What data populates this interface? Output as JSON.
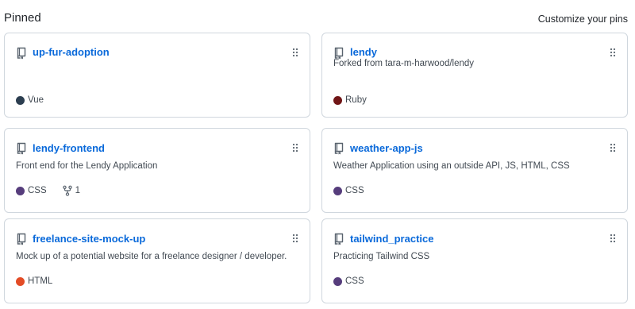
{
  "header": {
    "title": "Pinned",
    "customize": "Customize your pins"
  },
  "icons": {
    "repo": "repo-icon",
    "drag": "grabber-icon",
    "fork": "repo-forked-icon"
  },
  "cards": [
    {
      "name": "up-fur-adoption",
      "description": "",
      "language": "Vue",
      "language_color": "#2c3e50",
      "forks": ""
    },
    {
      "name": "lendy",
      "description": "Forked from tara-m-harwood/lendy",
      "language": "Ruby",
      "language_color": "#701516",
      "forks": ""
    },
    {
      "name": "lendy-frontend",
      "description": "Front end for the Lendy Application",
      "language": "CSS",
      "language_color": "#563d7c",
      "forks": "1"
    },
    {
      "name": "weather-app-js",
      "description": "Weather Application using an outside API, JS, HTML, CSS",
      "language": "CSS",
      "language_color": "#563d7c",
      "forks": ""
    },
    {
      "name": "freelance-site-mock-up",
      "description": "Mock up of a potential website for a freelance designer / developer.",
      "language": "HTML",
      "language_color": "#e34c26",
      "forks": ""
    },
    {
      "name": "tailwind_practice",
      "description": "Practicing Tailwind CSS",
      "language": "CSS",
      "language_color": "#563d7c",
      "forks": ""
    }
  ]
}
